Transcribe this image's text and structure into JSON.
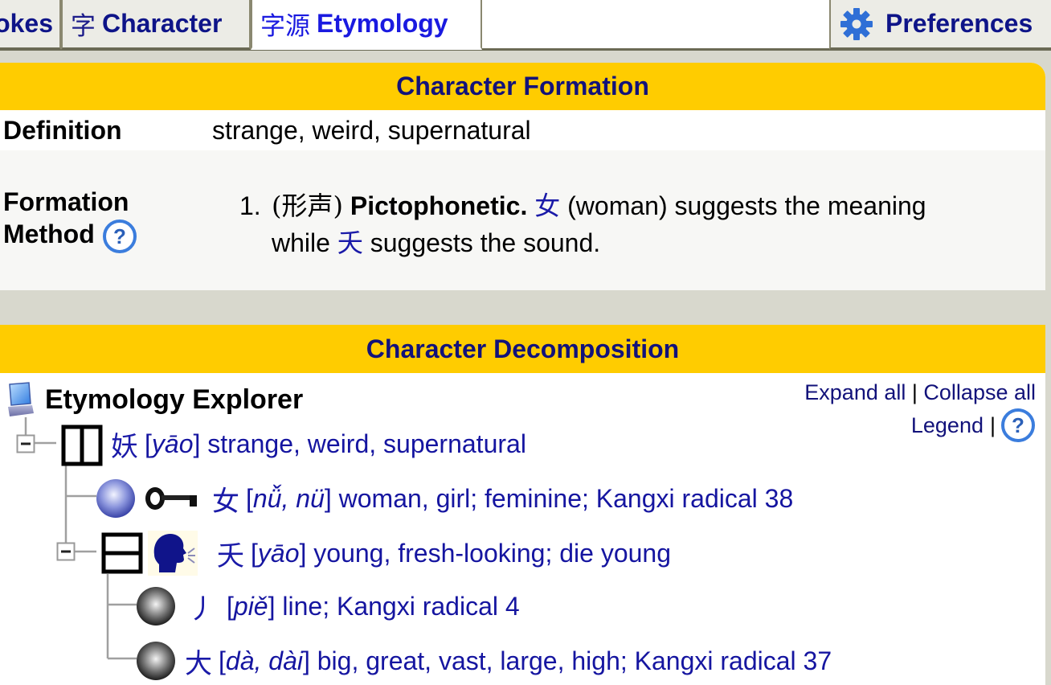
{
  "tabs": [
    {
      "id": "strokes",
      "cjk": "",
      "label": "okes",
      "active": false
    },
    {
      "id": "character",
      "cjk": "字",
      "label": "Character",
      "active": false
    },
    {
      "id": "etymology",
      "cjk": "字源",
      "label": "Etymology",
      "active": true
    },
    {
      "id": "preferences",
      "icon": "gear-icon",
      "label": "Preferences",
      "active": false
    }
  ],
  "formation": {
    "title": "Character Formation",
    "definition_label": "Definition",
    "definition_value": "strange, weird, supernatural",
    "method_label_1": "Formation",
    "method_label_2": "Method",
    "method": {
      "number": "1.",
      "type_cjk": "(形声)",
      "type_label": "Pictophonetic.",
      "component1": "女",
      "component1_gloss": "(woman) suggests the meaning",
      "while": "while",
      "component2": "夭",
      "component2_gloss": "suggests the sound."
    }
  },
  "decomposition": {
    "title": "Character Decomposition",
    "explorer_title": "Etymology Explorer",
    "expand_all": "Expand all",
    "separator": "|",
    "collapse_all": "Collapse all",
    "legend": "Legend",
    "nodes": [
      {
        "char": "妖",
        "pinyin": "yāo",
        "gloss": "strange, weird, supernatural",
        "structure": "left-right",
        "expanded": true
      },
      {
        "char": "女",
        "pinyin": "nǚ, nü",
        "gloss": "woman, girl; feminine; Kangxi radical 38",
        "role": "meaning",
        "type": "blue-ball"
      },
      {
        "char": "夭",
        "pinyin": "yāo",
        "gloss": "young, fresh-looking; die young",
        "structure": "top-bottom",
        "role": "sound",
        "expanded": true
      },
      {
        "char": "丿",
        "pinyin": "piě",
        "gloss": "line; Kangxi radical 4",
        "type": "black-ball"
      },
      {
        "char": "大",
        "pinyin": "dà, dài",
        "gloss": "big, great, vast, large, high; Kangxi radical 37",
        "type": "black-ball"
      }
    ]
  },
  "colors": {
    "header_bg": "#ffcc00",
    "header_text": "#12127a",
    "link": "#1515a0",
    "active_tab_text": "#1a1ae0"
  }
}
